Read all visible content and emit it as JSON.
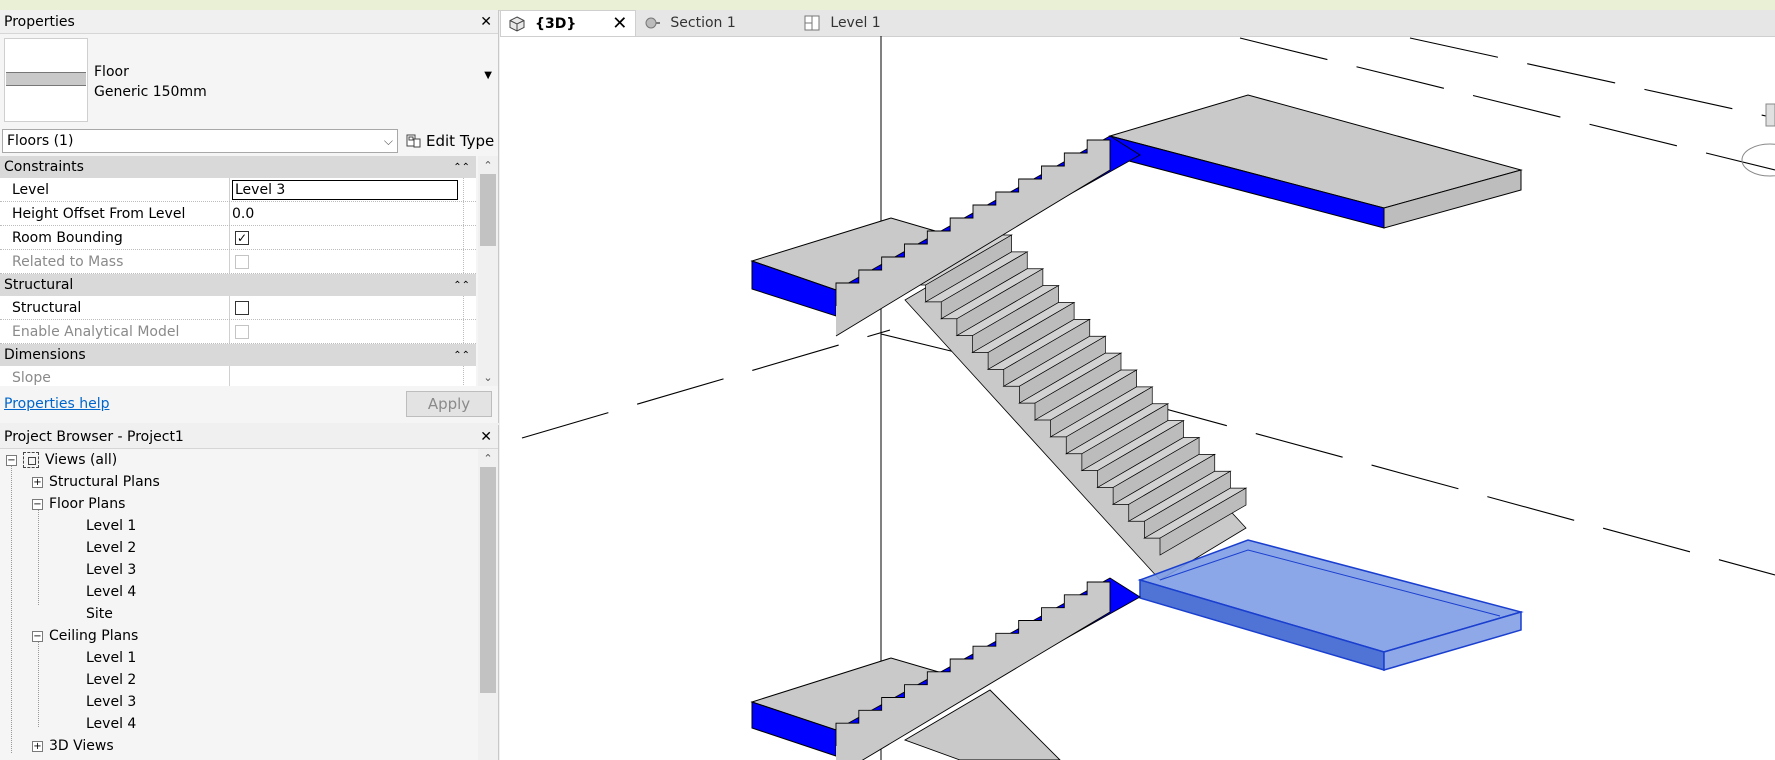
{
  "properties": {
    "title": "Properties",
    "type_family": "Floor",
    "type_name": "Generic 150mm",
    "selector": "Floors (1)",
    "edit_type": "Edit Type",
    "groups": [
      {
        "name": "Constraints",
        "rows": [
          {
            "label": "Level",
            "value": "Level 3"
          },
          {
            "label": "Height Offset From Level",
            "value": "0.0"
          },
          {
            "label": "Room Bounding",
            "checked": true
          },
          {
            "label": "Related to Mass",
            "checked": false
          }
        ]
      },
      {
        "name": "Structural",
        "rows": [
          {
            "label": "Structural",
            "checked": false
          },
          {
            "label": "Enable Analytical Model",
            "checked": false
          }
        ]
      },
      {
        "name": "Dimensions",
        "rows": [
          {
            "label": "Slope",
            "value": ""
          }
        ]
      }
    ],
    "help_link": "Properties help",
    "apply": "Apply"
  },
  "browser": {
    "title": "Project Browser - Project1",
    "root": "Views (all)",
    "structural_plans": "Structural Plans",
    "floor_plans": {
      "label": "Floor Plans",
      "items": [
        "Level 1",
        "Level 2",
        "Level 3",
        "Level 4",
        "Site"
      ]
    },
    "ceiling_plans": {
      "label": "Ceiling Plans",
      "items": [
        "Level 1",
        "Level 2",
        "Level 3",
        "Level 4"
      ]
    },
    "views_3d": "3D Views"
  },
  "tabs": [
    {
      "label": "{3D}",
      "icon": "cube-icon",
      "active": true
    },
    {
      "label": "Section 1",
      "icon": "section-icon",
      "active": false
    },
    {
      "label": "Level 1",
      "icon": "plan-icon",
      "active": false
    }
  ],
  "colors": {
    "cut_blue": "#0000ff",
    "selection_blue": "#4a78dc",
    "concrete_gray": "#c8c8c8"
  }
}
